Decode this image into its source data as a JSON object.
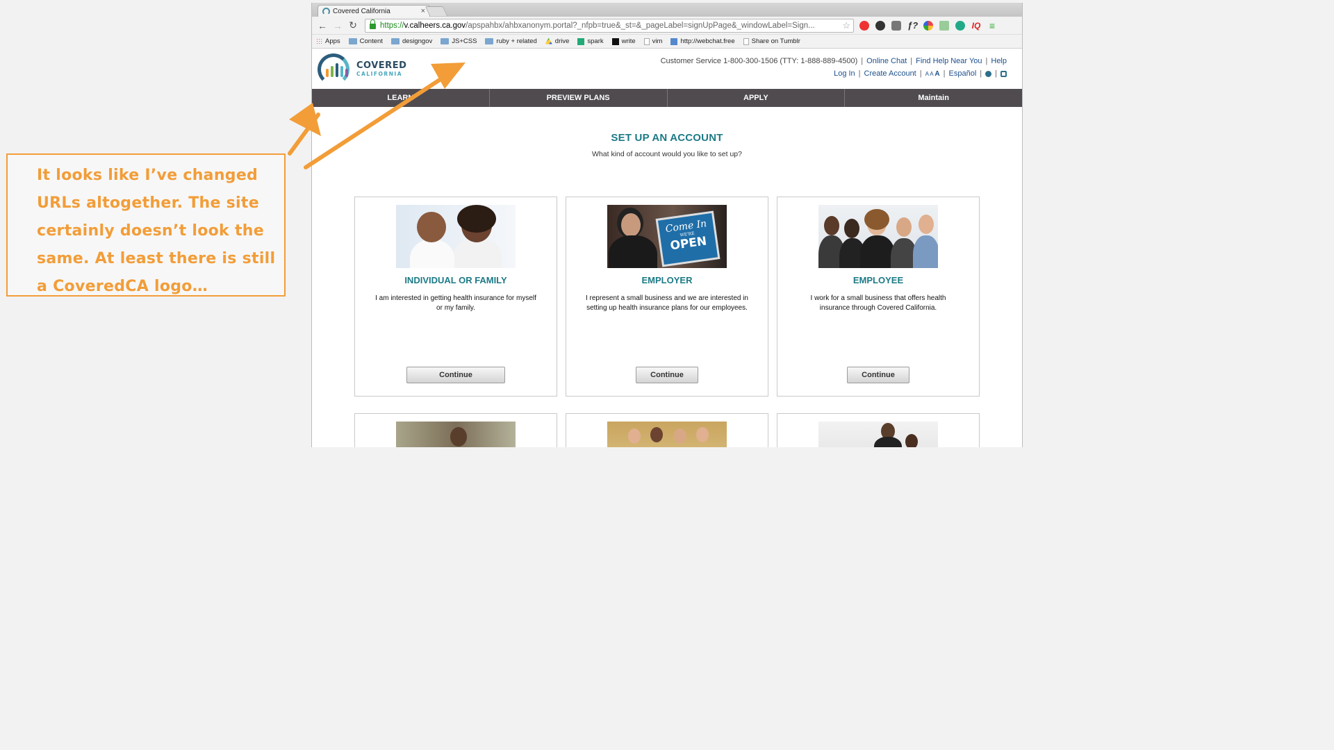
{
  "browser": {
    "tab_title": "Covered California",
    "tab_close": "×",
    "url_scheme": "https://",
    "url_host": "v.calheers.ca.gov",
    "url_rest": "/apspahbx/ahbxanonym.portal?_nfpb=true&_st=&_pageLabel=signUpPage&_windowLabel=Sign...",
    "back": "←",
    "forward": "→",
    "reload": "↻",
    "star": "☆",
    "bookmarks": [
      "Apps",
      "Content",
      "designgov",
      "JS+CSS",
      "ruby + related",
      "drive",
      "spark",
      "write",
      "vim",
      "http://webchat.free",
      "Share on Tumblr"
    ],
    "ext_labels": {
      "f": "ƒ?",
      "iq": "IQ",
      "menu": "≡"
    }
  },
  "header": {
    "logo_line1": "COVERED",
    "logo_line2": "CALIFORNIA",
    "customer_service": "Customer Service 1-800-300-1506 (TTY: 1-888-889-4500)",
    "online_chat": "Online Chat",
    "find_help": "Find Help Near You",
    "help": "Help",
    "login": "Log In",
    "create_account": "Create Account",
    "font_size_small": "A A",
    "font_size_large": "A",
    "espanol": "Español"
  },
  "nav": {
    "items": [
      "LEARN",
      "PREVIEW PLANS",
      "APPLY",
      "Maintain"
    ]
  },
  "content": {
    "title": "SET UP AN ACCOUNT",
    "subtitle": "What kind of account would you like to set up?",
    "cards": [
      {
        "title": "INDIVIDUAL OR FAMILY",
        "desc": "I am interested in getting health insurance for myself or my family.",
        "button": "Continue"
      },
      {
        "title": "EMPLOYER",
        "desc": "I represent a small business and we are interested in setting up health insurance plans for our employees.",
        "button": "Continue",
        "sign_line1": "Come In",
        "sign_line2": "WE'RE",
        "sign_line3": "OPEN"
      },
      {
        "title": "EMPLOYEE",
        "desc": "I work for a small business that offers health insurance through Covered California.",
        "button": "Continue"
      }
    ]
  },
  "annotation": {
    "text": "It looks like I’ve changed URLs altogether. The site certainly doesn’t look the same. At least there is still a CoveredCA logo…",
    "color": "#f29d38"
  },
  "colors": {
    "accent_teal": "#1c7a86",
    "nav_bg": "#4f4b4f",
    "link_blue": "#1c4f8c"
  }
}
